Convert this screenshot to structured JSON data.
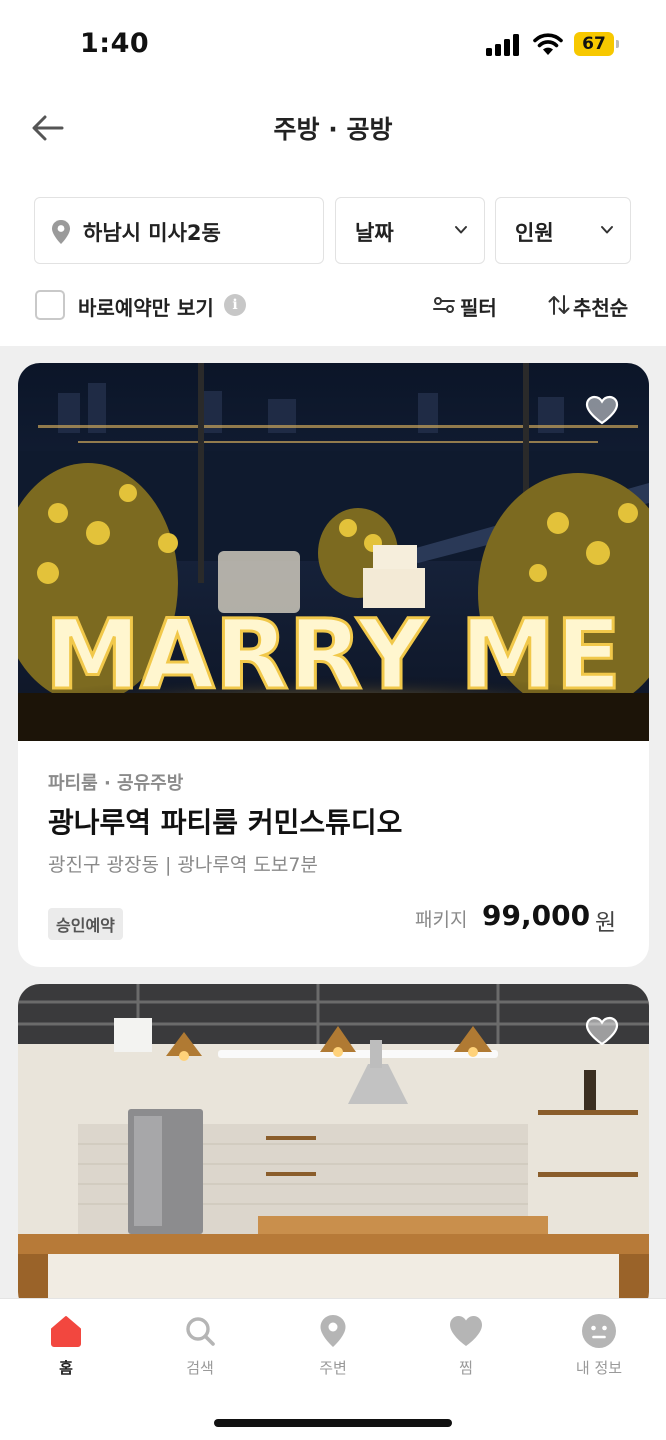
{
  "status_bar": {
    "time": "1:40",
    "battery": "67"
  },
  "header": {
    "title": "주방 · 공방"
  },
  "filters": {
    "location": "하남시 미사2동",
    "date": "날짜",
    "people": "인원",
    "instant_only": "바로예약만 보기",
    "filter": "필터",
    "sort": "추천순"
  },
  "listings": [
    {
      "category": "파티룸 · 공유주방",
      "title": "광나루역 파티룸 커민스튜디오",
      "address": "광진구 광장동 | 광나루역 도보7분",
      "badge": "승인예약",
      "price_label": "패키지",
      "price": "99,000",
      "price_unit": "원",
      "photo_sign": "MARRY ME"
    },
    {
      "category": "",
      "title": "",
      "address": ""
    }
  ],
  "tabbar": {
    "items": [
      {
        "label": "홈",
        "icon": "home-icon"
      },
      {
        "label": "검색",
        "icon": "search-icon"
      },
      {
        "label": "주변",
        "icon": "location-pin-icon"
      },
      {
        "label": "찜",
        "icon": "heart-icon"
      },
      {
        "label": "내 정보",
        "icon": "profile-icon"
      }
    ]
  },
  "colors": {
    "accent": "#f2473f",
    "battery": "#f7c800",
    "inactive": "#b5b5b5",
    "background": "#efefef"
  }
}
